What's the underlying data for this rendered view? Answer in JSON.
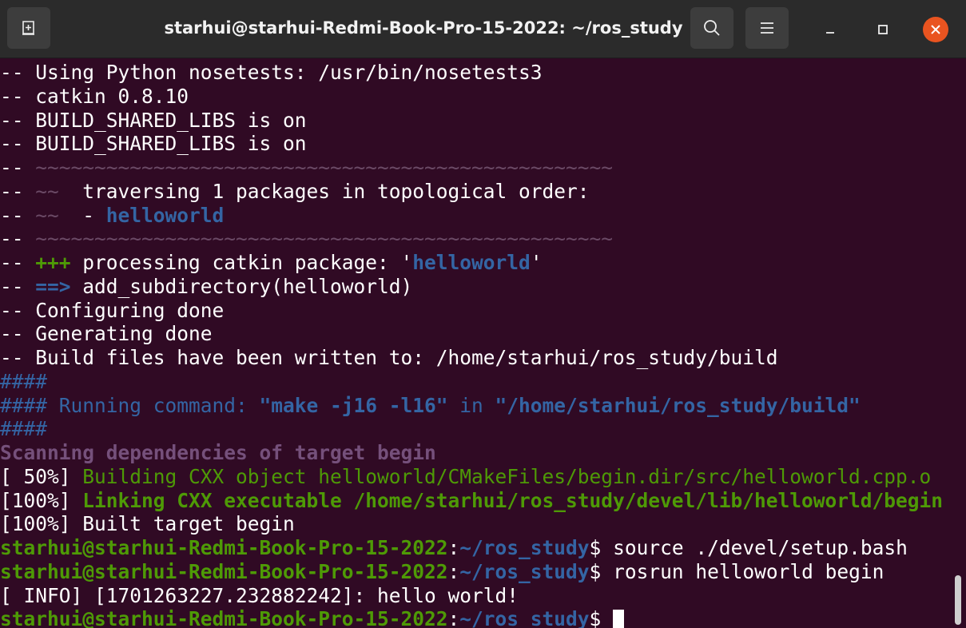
{
  "window": {
    "title": "starhui@starhui-Redmi-Book-Pro-15-2022: ~/ros_study"
  },
  "icons": {
    "new_tab": "new-tab-icon",
    "search": "search-icon",
    "menu": "hamburger-menu-icon",
    "minimize": "minimize-icon",
    "maximize": "maximize-icon",
    "close": "close-icon"
  },
  "colors": {
    "terminal_bg": "#300a24",
    "green": "#4e9a06",
    "blue": "#3465a4",
    "magenta": "#75507b",
    "close_button": "#e95420"
  },
  "terminal": {
    "l1": "-- Using Python nosetests: /usr/bin/nosetests3",
    "l2": "-- catkin 0.8.10",
    "l3": "-- BUILD_SHARED_LIBS is on",
    "l4": "-- BUILD_SHARED_LIBS is on",
    "l5a": "-- ",
    "l5b": "~~~~~~~~~~~~~~~~~~~~~~~~~~~~~~~~~~~~~~~~~~~~~~~~~",
    "l6a": "-- ",
    "l6b": "~~",
    "l6c": "  traversing 1 packages in topological order:",
    "l7a": "-- ",
    "l7b": "~~",
    "l7c": "  - ",
    "l7d": "helloworld",
    "l8a": "-- ",
    "l8b": "~~~~~~~~~~~~~~~~~~~~~~~~~~~~~~~~~~~~~~~~~~~~~~~~~",
    "l9a": "-- ",
    "l9b": "+++",
    "l9c": " processing catkin package: '",
    "l9d": "helloworld",
    "l9e": "'",
    "l10a": "-- ",
    "l10b": "==>",
    "l10c": " add_subdirectory(helloworld)",
    "l11": "-- Configuring done",
    "l12": "-- Generating done",
    "l13": "-- Build files have been written to: /home/starhui/ros_study/build",
    "l14": "####",
    "l15a": "#### Running command: ",
    "l15b": "\"make -j16 -l16\"",
    "l15c": " in ",
    "l15d": "\"/home/starhui/ros_study/build\"",
    "l16": "####",
    "l17": "Scanning dependencies of target begin",
    "l18a": "[ 50%] ",
    "l18b": "Building CXX object helloworld/CMakeFiles/begin.dir/src/helloworld.cpp.o",
    "l19a": "[100%] ",
    "l19b": "Linking CXX executable /home/starhui/ros_study/devel/lib/helloworld/begin",
    "l20": "[100%] Built target begin",
    "prompt_user": "starhui@starhui-Redmi-Book-Pro-15-2022",
    "prompt_colon": ":",
    "prompt_path": "~/ros_study",
    "prompt_dollar": "$ ",
    "cmd1": "source ./devel/setup.bash",
    "cmd2": "rosrun helloworld begin",
    "l23": "[ INFO] [1701263227.232882242]: hello world!"
  }
}
